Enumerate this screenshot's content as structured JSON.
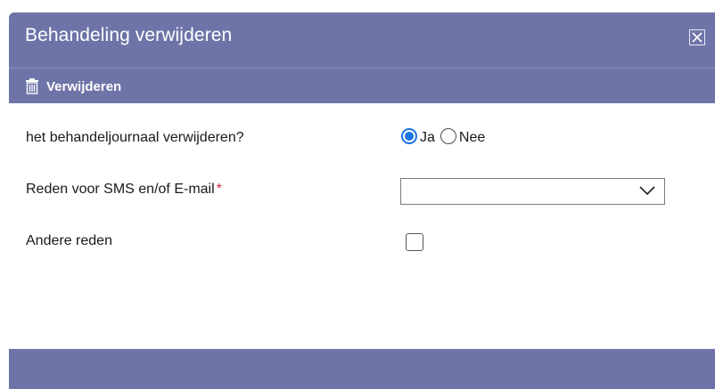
{
  "dialog": {
    "title": "Behandeling verwijderen",
    "close_icon": "close-icon",
    "toolbar": {
      "delete_label": "Verwijderen",
      "delete_icon": "trash-icon"
    }
  },
  "form": {
    "journal_question": "het behandeljournaal verwijderen?",
    "radio_yes_label": "Ja",
    "radio_no_label": "Nee",
    "radio_selected": "Ja",
    "reason_label": "Reden voor SMS en/of E-mail",
    "required_marker": "*",
    "reason_value": "",
    "other_reason_label": "Andere reden",
    "other_reason_checked": false
  },
  "colors": {
    "header_bg": "#6f74a8",
    "radio_accent": "#1a73e8",
    "required": "#c8283b"
  }
}
